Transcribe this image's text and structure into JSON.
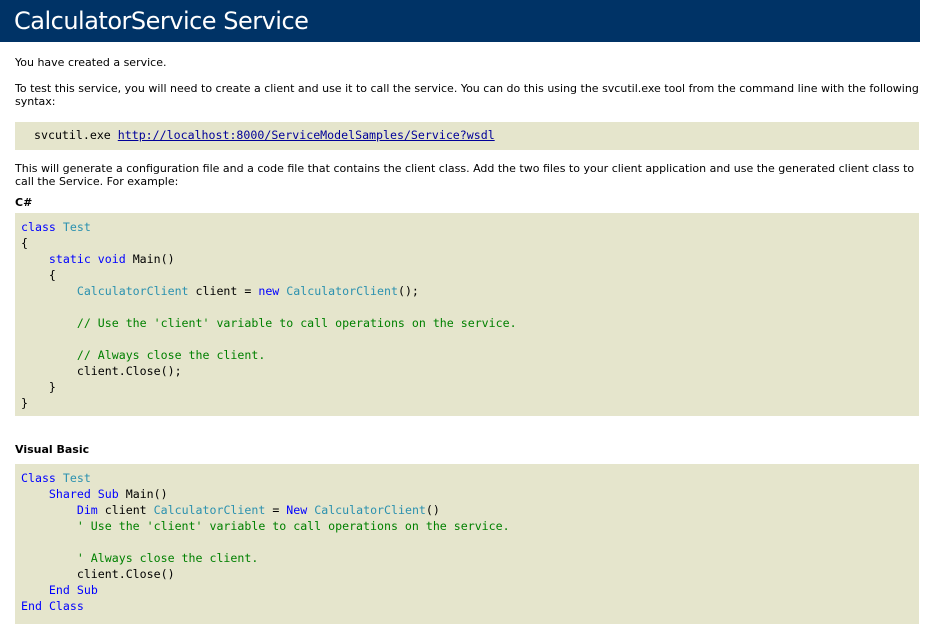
{
  "header": {
    "title": "CalculatorService Service"
  },
  "intro_text": "You have created a service.",
  "instructions_text": "To test this service, you will need to create a client and use it to call the service. You can do this using the svcutil.exe tool from the command line with the following syntax:",
  "command": {
    "tool": "svcutil.exe",
    "url": "http://localhost:8000/ServiceModelSamples/Service?wsdl"
  },
  "generate_text": "This will generate a configuration file and a code file that contains the client class. Add the two files to your client application and use the generated client class to call the Service. For example:",
  "csharp": {
    "label": "C#",
    "kw_class": "class",
    "type_test": "Test",
    "brace_open": "{",
    "brace_close": "}",
    "kw_static": "static",
    "kw_void": "void",
    "main_sig": "Main()",
    "type_client": "CalculatorClient",
    "var_client": "client =",
    "kw_new": "new",
    "ctor_call": "CalculatorClient",
    "ctor_end": "();",
    "comment_use": "// Use the 'client' variable to call operations on the service.",
    "comment_close": "// Always close the client.",
    "close_call": "client.Close();"
  },
  "vb": {
    "label": "Visual Basic",
    "kw_class": "Class",
    "type_test": "Test",
    "kw_shared": "Shared",
    "kw_sub": "Sub",
    "main_sig": "Main()",
    "kw_dim": "Dim",
    "var_client": "client",
    "type_client": "CalculatorClient",
    "assign": "=",
    "kw_new": "New",
    "ctor_call": "CalculatorClient",
    "ctor_end": "()",
    "comment_use": "' Use the 'client' variable to call operations on the service.",
    "comment_close": "' Always close the client.",
    "close_call": "client.Close()",
    "kw_end": "End",
    "kw_end_sub": "Sub",
    "kw_end_class": "Class"
  },
  "colors": {
    "header_bg": "#003366",
    "code_bg": "#e5e5cc",
    "keyword": "#0000ff",
    "type": "#2b91af",
    "comment": "#008000",
    "link": "#000099"
  }
}
